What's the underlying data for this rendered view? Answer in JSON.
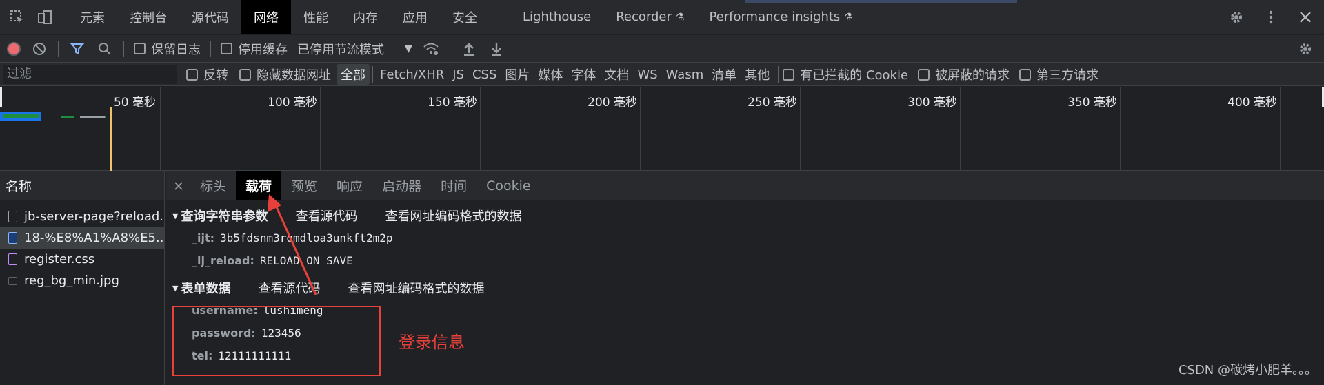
{
  "tabs": [
    "元素",
    "控制台",
    "源代码",
    "网络",
    "性能",
    "内存",
    "应用",
    "安全",
    "Lighthouse",
    "Recorder",
    "Performance insights"
  ],
  "active_tab": "网络",
  "toolbar": {
    "preserve_log": "保留日志",
    "disable_cache": "停用缓存",
    "throttle": "已停用节流模式"
  },
  "filter": {
    "placeholder": "过滤",
    "invert": "反转",
    "hide_data_urls": "隐藏数据网址",
    "types": [
      "全部",
      "Fetch/XHR",
      "JS",
      "CSS",
      "图片",
      "媒体",
      "字体",
      "文档",
      "WS",
      "Wasm",
      "清单",
      "其他"
    ],
    "blocked_cookies": "有已拦截的 Cookie",
    "blocked_requests": "被屏蔽的请求",
    "third_party": "第三方请求"
  },
  "timeline_ticks": [
    "50 毫秒",
    "100 毫秒",
    "150 毫秒",
    "200 毫秒",
    "250 毫秒",
    "300 毫秒",
    "350 毫秒",
    "400 毫秒"
  ],
  "requests": {
    "header": "名称",
    "items": [
      {
        "name": "jb-server-page?reload...",
        "type": "doc"
      },
      {
        "name": "18-%E8%A1%A8%E5...",
        "type": "doc-blue"
      },
      {
        "name": "register.css",
        "type": "css"
      },
      {
        "name": "reg_bg_min.jpg",
        "type": "img"
      }
    ]
  },
  "detail_tabs": [
    "标头",
    "载荷",
    "预览",
    "响应",
    "启动器",
    "时间",
    "Cookie"
  ],
  "active_detail_tab": "载荷",
  "query_section": {
    "title": "查询字符串参数",
    "view_source": "查看源代码",
    "view_url_encoded": "查看网址编码格式的数据",
    "params": [
      {
        "key": "_ijt:",
        "value": "3b5fdsnm3romdloa3unkft2m2p"
      },
      {
        "key": "_ij_reload:",
        "value": "RELOAD_ON_SAVE"
      }
    ]
  },
  "form_section": {
    "title": "表单数据",
    "view_source": "查看源代码",
    "view_url_encoded": "查看网址编码格式的数据",
    "params": [
      {
        "key": "username:",
        "value": "lushimeng"
      },
      {
        "key": "password:",
        "value": "123456"
      },
      {
        "key": "tel:",
        "value": "12111111111"
      }
    ]
  },
  "annotation": "登录信息",
  "watermark": "CSDN @碳烤小肥羊。。。",
  "colors": {
    "accent_red": "#e8403a",
    "record_red": "#ee6a6f",
    "filter_blue": "#8ab4f8"
  }
}
